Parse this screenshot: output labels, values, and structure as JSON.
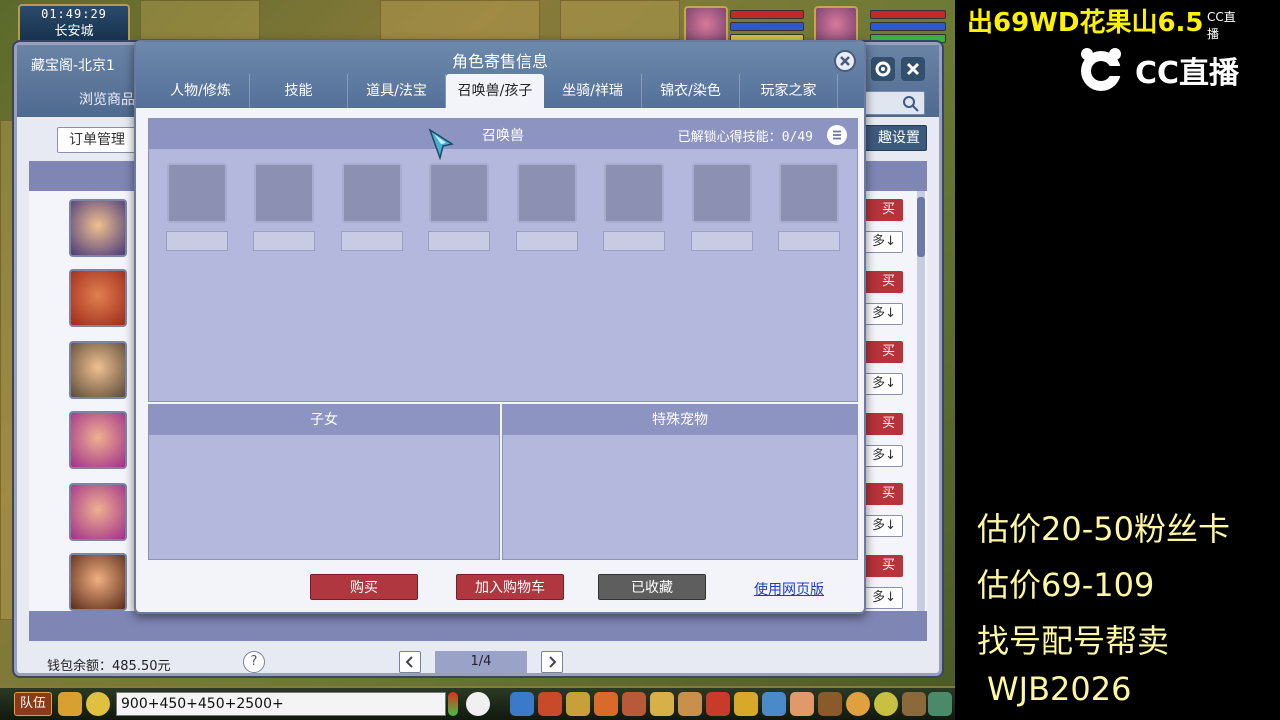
{
  "game": {
    "clock_time": "01:49:29",
    "city": "长安城",
    "chat_input_value": "900+450+450+2500+",
    "team_label": "队伍"
  },
  "cbg": {
    "title": "藏宝阁-北京1",
    "browse_label": "浏览商品",
    "order_label": "订单管理",
    "settings_label": "趣设置",
    "buy_label": "买",
    "more_label": "多↓",
    "wallet_label": "钱包余额：485.50元",
    "help_label": "?",
    "page_label": "1/4"
  },
  "dialog": {
    "title": "角色寄售信息",
    "tabs": [
      {
        "label": "人物/修炼"
      },
      {
        "label": "技能"
      },
      {
        "label": "道具/法宝"
      },
      {
        "label": "召唤兽/孩子"
      },
      {
        "label": "坐骑/祥瑞"
      },
      {
        "label": "锦衣/染色"
      },
      {
        "label": "玩家之家"
      }
    ],
    "active_tab": "召唤兽/孩子",
    "pet_title": "召唤兽",
    "skill_label": "已解锁心得技能：",
    "skill_count": "0/49",
    "kids_title": "子女",
    "special_title": "特殊宠物",
    "buy_button": "购买",
    "cart_button": "加入购物车",
    "fav_button": "已收藏",
    "web_link": "使用网页版"
  },
  "stream": {
    "title": "出69WD花果山6.5",
    "logo_text": "CC直播",
    "logo_mini": "CC直播",
    "lines": [
      "估价20-50粉丝卡",
      "估价69-109",
      "找号配号帮卖",
      "WJB2026"
    ]
  },
  "colors": {
    "dialog_header": "#5f7ca2",
    "panel_bg": "#b4b8dc",
    "buy_red": "#b03640",
    "stream_yellow": "#fff200"
  }
}
